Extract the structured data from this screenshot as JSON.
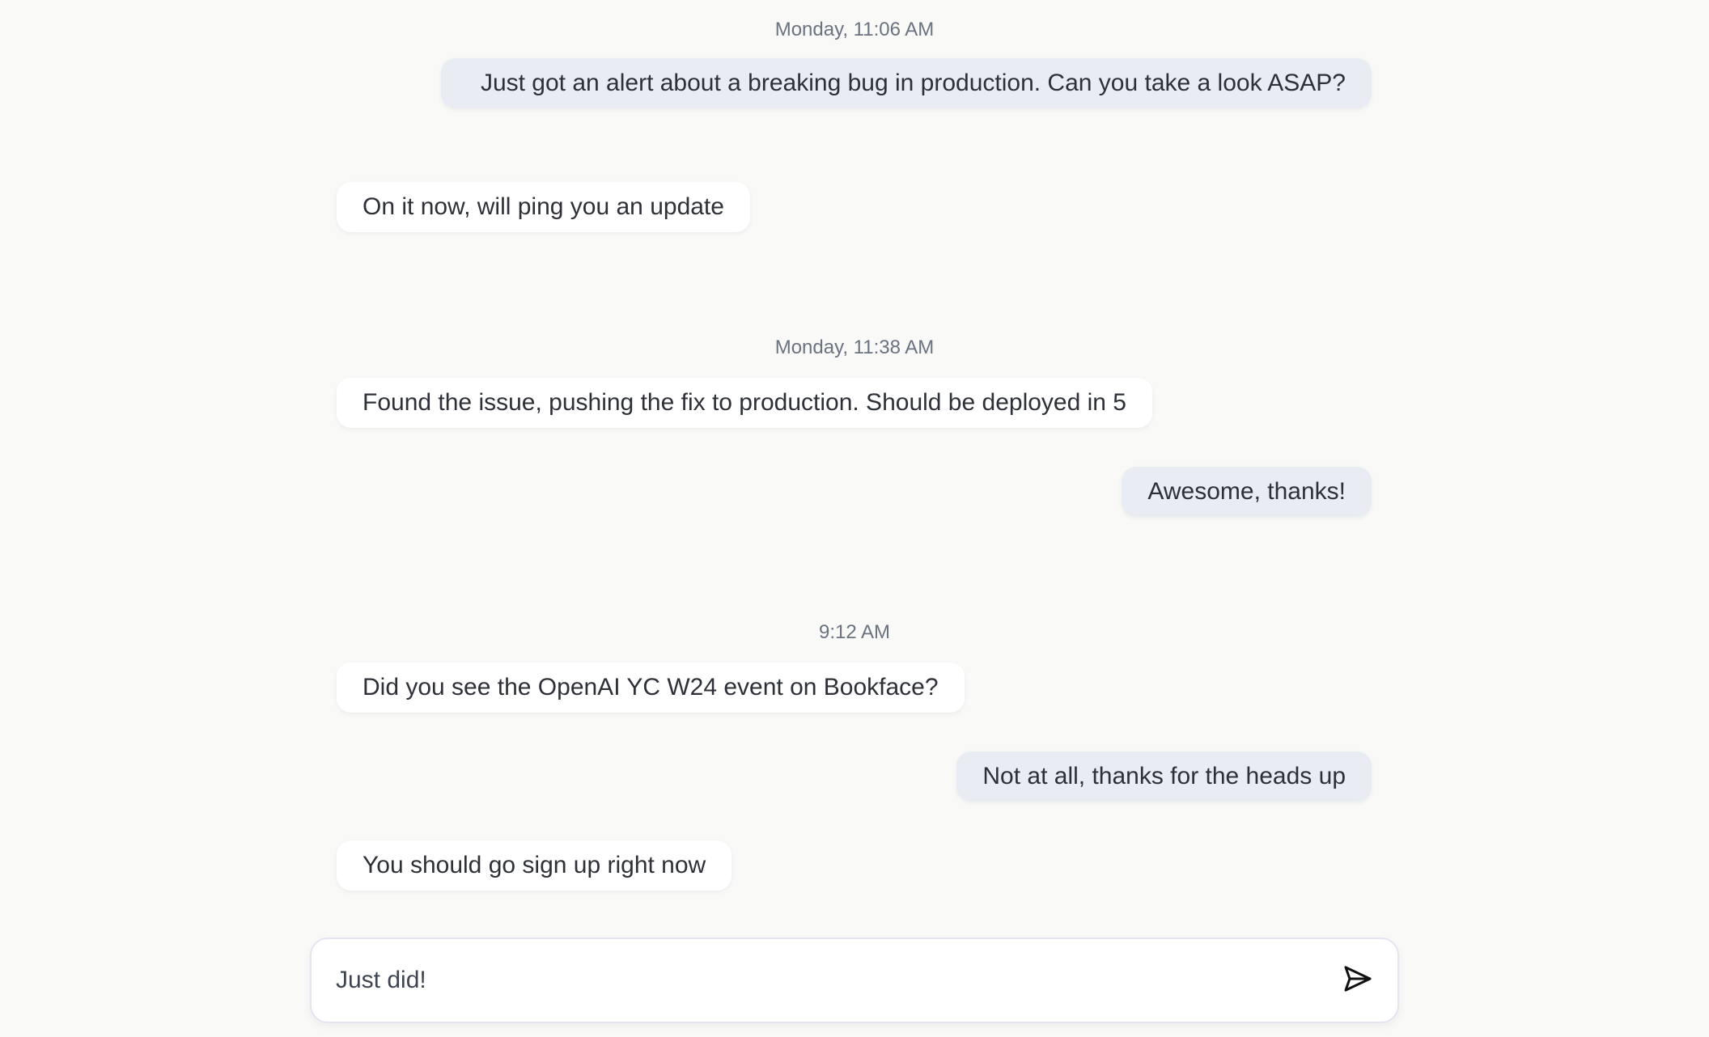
{
  "messages": [
    {
      "type": "timestamp",
      "text": "Monday, 11:06 AM"
    },
    {
      "type": "outgoing",
      "text": "Just got an alert about a breaking bug in production. Can you take a look ASAP?"
    },
    {
      "type": "incoming",
      "text": "On it now, will ping you an update"
    },
    {
      "type": "timestamp",
      "text": "Monday, 11:38 AM"
    },
    {
      "type": "incoming",
      "text": "Found the issue, pushing the fix to production. Should be deployed in 5"
    },
    {
      "type": "outgoing",
      "text": "Awesome, thanks!"
    },
    {
      "type": "timestamp",
      "text": "9:12 AM"
    },
    {
      "type": "incoming",
      "text": "Did you see the OpenAI YC W24 event on Bookface?"
    },
    {
      "type": "outgoing",
      "text": "Not at all, thanks for the heads up"
    },
    {
      "type": "incoming",
      "text": "You should go sign up right now"
    }
  ],
  "composer": {
    "value": "Just did!",
    "send_icon": "send-icon"
  },
  "colors": {
    "background": "#f9f9f8",
    "incoming_bubble": "#ffffff",
    "outgoing_bubble": "#e9ecf3",
    "timestamp_text": "#6b7280",
    "message_text": "#2d3137"
  }
}
